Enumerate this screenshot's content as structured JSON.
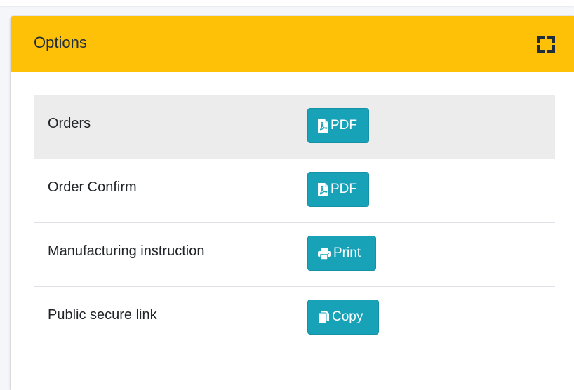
{
  "card": {
    "title": "Options",
    "header_color": "#ffc107"
  },
  "icons": {
    "maximize": "expand-icon",
    "pdf": "file-pdf-icon",
    "print": "print-icon",
    "copy": "copy-icon"
  },
  "rows": [
    {
      "label": "Orders",
      "action": "PDF",
      "icon": "file-pdf-icon"
    },
    {
      "label": "Order Confirm",
      "action": "PDF",
      "icon": "file-pdf-icon"
    },
    {
      "label": "Manufacturing instruction",
      "action": "Print",
      "icon": "print-icon"
    },
    {
      "label": "Public secure link",
      "action": "Copy",
      "icon": "copy-icon"
    }
  ],
  "colors": {
    "button": "#17a2b8",
    "striped_row": "#ececec"
  }
}
